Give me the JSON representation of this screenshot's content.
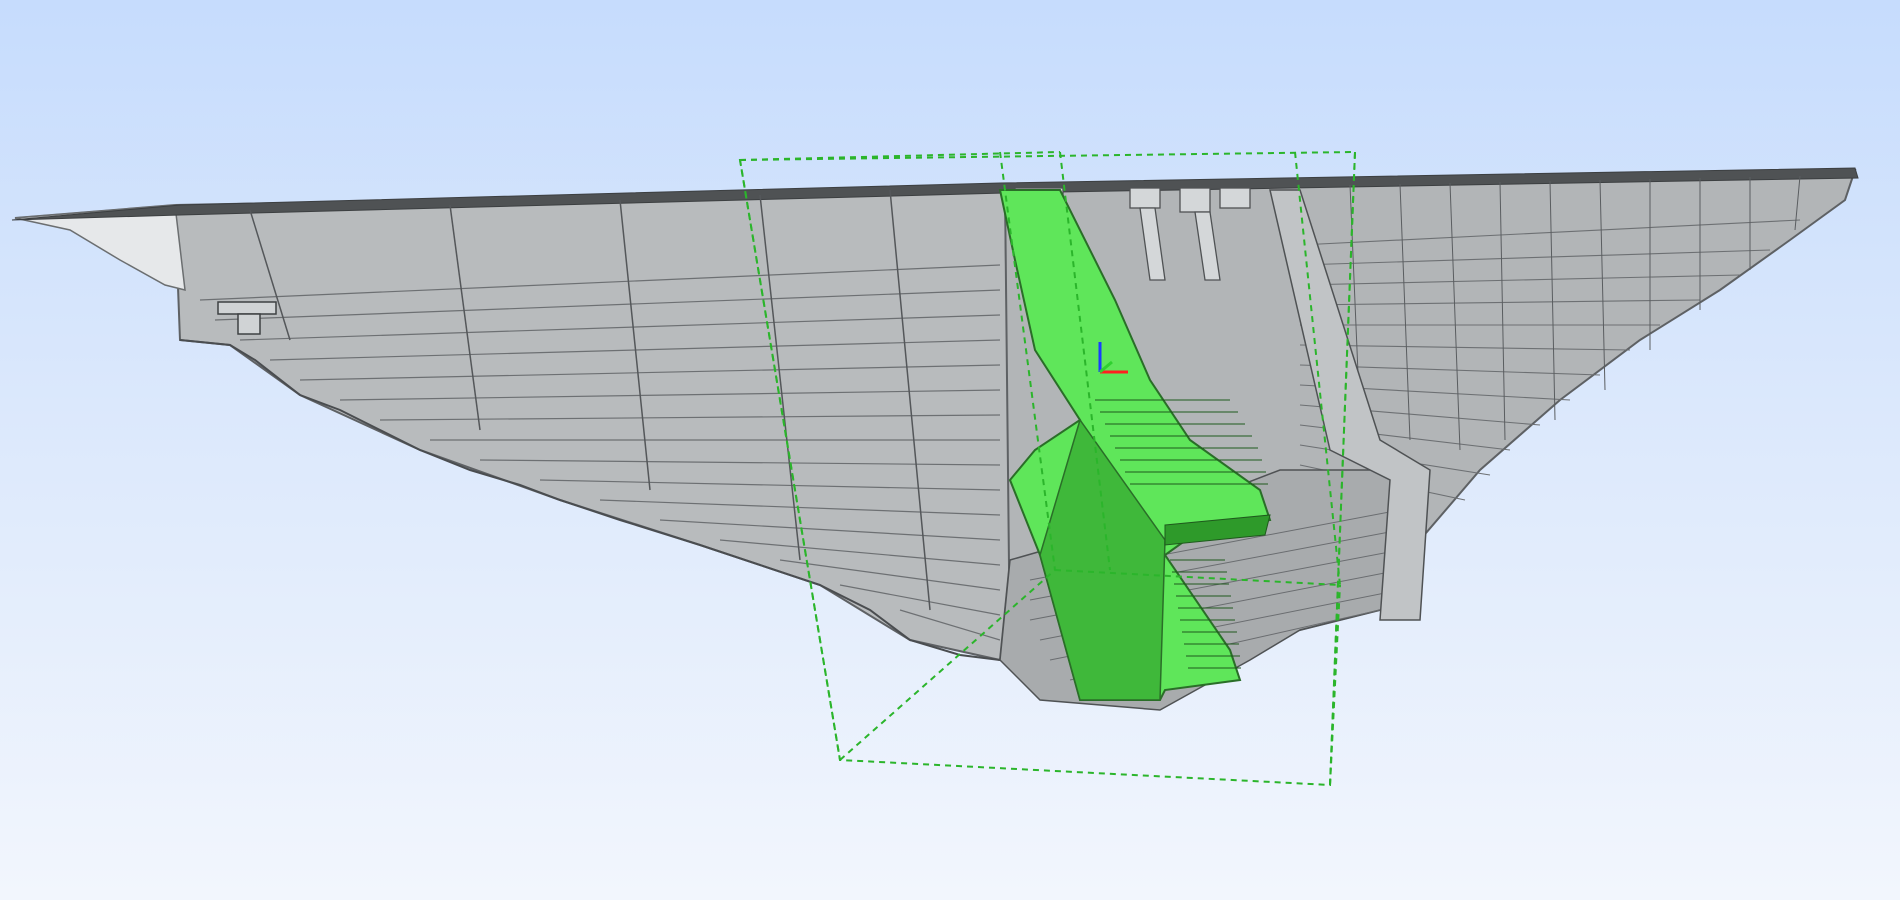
{
  "viewport": {
    "background_top": "#c6dcfd",
    "background_bottom": "#f2f6fd"
  },
  "model": {
    "body_color": "#b6b9bb",
    "body_light_color": "#c4c7c9",
    "edge_color": "#5e6164",
    "crest_color": "#6b6e70",
    "selection_color": "#5fe65a",
    "selection_dark_color": "#3fb83a",
    "bounding_box_color": "#2bb52b"
  },
  "axis_triad": {
    "icon": "axis-triad-icon",
    "x_color": "#ff2020",
    "y_color": "#2fd12f",
    "z_color": "#1a3cff"
  }
}
